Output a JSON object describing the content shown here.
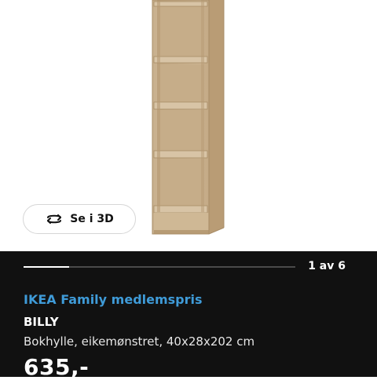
{
  "product_image": {
    "view_3d_label": "Se i 3D",
    "icon": "rotate-360-icon"
  },
  "gallery": {
    "counter": "1 av 6",
    "current": 1,
    "total": 6,
    "progress_fraction": 0.167
  },
  "product": {
    "family_price_label": "IKEA Family medlemspris",
    "name": "BILLY",
    "description": "Bokhylle, eikemønstret, 40x28x202 cm",
    "price": "635,-"
  },
  "colors": {
    "panel_bg": "#111111",
    "family_blue": "#3f9bd8",
    "wood": "#c9b08d"
  }
}
